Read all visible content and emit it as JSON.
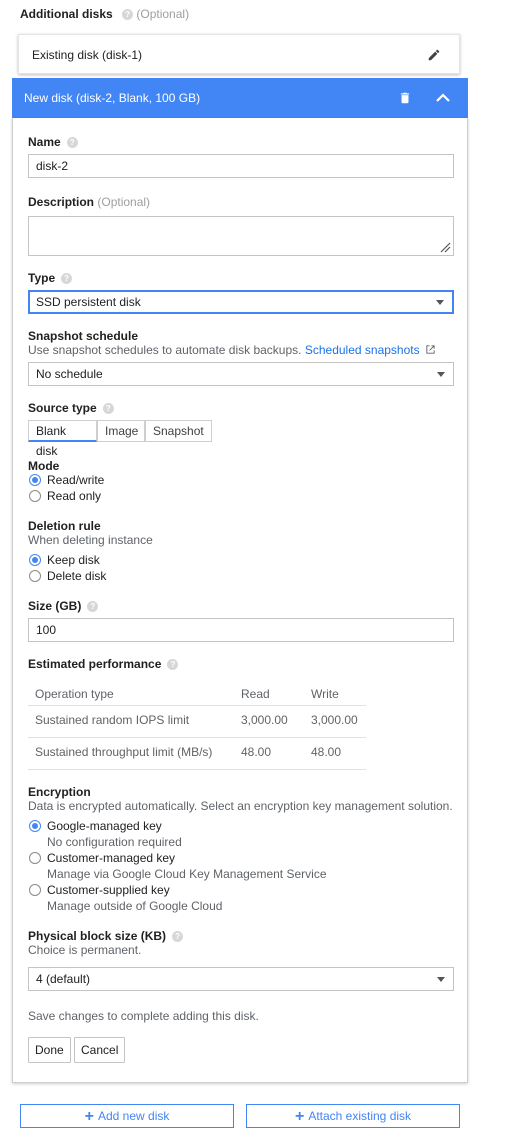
{
  "header": {
    "title": "Additional disks",
    "optional": "(Optional)"
  },
  "existing_disk": {
    "label": "Existing disk (disk-1)",
    "icon": "pencil-icon"
  },
  "new_disk": {
    "title": "New disk (disk-2, Blank, 100 GB)",
    "icons": [
      "trash-icon",
      "chevron-up-icon"
    ],
    "accent": "#4285f4"
  },
  "name": {
    "label": "Name",
    "value": "disk-2"
  },
  "description": {
    "label": "Description",
    "optional": "(Optional)",
    "value": ""
  },
  "type": {
    "label": "Type",
    "value": "SSD persistent disk"
  },
  "snapshot": {
    "label": "Snapshot schedule",
    "help_text": "Use snapshot schedules to automate disk backups.",
    "link": "Scheduled snapshots",
    "value": "No schedule"
  },
  "source_type": {
    "label": "Source type",
    "tabs": [
      "Blank disk",
      "Image",
      "Snapshot"
    ],
    "selected": "Blank disk"
  },
  "mode": {
    "label": "Mode",
    "options": [
      "Read/write",
      "Read only"
    ],
    "selected": "Read/write"
  },
  "deletion": {
    "label": "Deletion rule",
    "sub": "When deleting instance",
    "options": [
      "Keep disk",
      "Delete disk"
    ],
    "selected": "Keep disk"
  },
  "size": {
    "label": "Size (GB)",
    "value": "100"
  },
  "performance": {
    "label": "Estimated performance",
    "headers": [
      "Operation type",
      "Read",
      "Write"
    ],
    "rows": [
      [
        "Sustained random IOPS limit",
        "3,000.00",
        "3,000.00"
      ],
      [
        "Sustained throughput limit (MB/s)",
        "48.00",
        "48.00"
      ]
    ]
  },
  "encryption": {
    "label": "Encryption",
    "sub": "Data is encrypted automatically. Select an encryption key management solution.",
    "options": [
      {
        "label": "Google-managed key",
        "desc": "No configuration required"
      },
      {
        "label": "Customer-managed key",
        "desc": "Manage via Google Cloud Key Management Service"
      },
      {
        "label": "Customer-supplied key",
        "desc": "Manage outside of Google Cloud"
      }
    ],
    "selected": "Google-managed key"
  },
  "block_size": {
    "label": "Physical block size (KB)",
    "sub": "Choice is permanent.",
    "value": "4 (default)"
  },
  "footer_note": "Save changes to complete adding this disk.",
  "actions": {
    "done": "Done",
    "cancel": "Cancel"
  },
  "bottom": {
    "add_new": "Add new disk",
    "attach": "Attach existing disk"
  }
}
